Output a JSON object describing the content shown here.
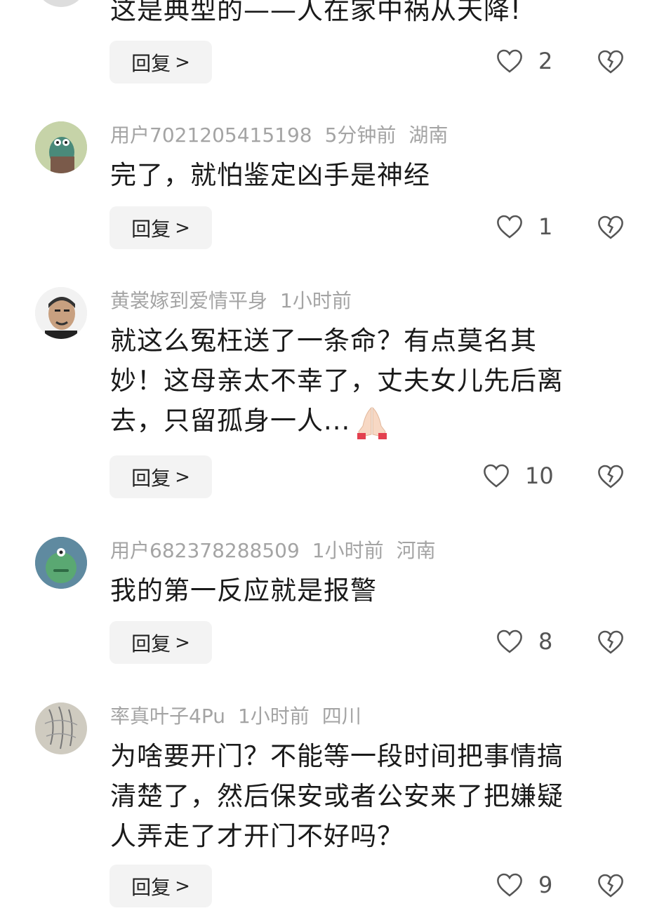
{
  "comments": [
    {
      "text": "这是典型的——人在家中祸从天降!",
      "reply_label": "回复",
      "likes": "2"
    },
    {
      "username": "用户7021205415198",
      "time": "5分钟前",
      "location": "湖南",
      "text": "完了，就怕鉴定凶手是神经",
      "reply_label": "回复",
      "likes": "1"
    },
    {
      "username": "黄裳嫁到爱情平身",
      "time": "1小时前",
      "text_lines": [
        "就这么冤枉送了一条命？有点莫名其",
        "妙！这母亲太不幸了，丈夫女儿先后离",
        "去，只留孤身一人..."
      ],
      "reply_label": "回复",
      "likes": "10"
    },
    {
      "username": "用户682378288509",
      "time": "1小时前",
      "location": "河南",
      "text": "我的第一反应就是报警",
      "reply_label": "回复",
      "likes": "8"
    },
    {
      "username": "率真叶子4Pu",
      "time": "1小时前",
      "location": "四川",
      "text_lines": [
        "为啥要开门？不能等一段时间把事情搞",
        "清楚了，然后保安或者公安来了把嫌疑",
        "人弄走了才开门不好吗？"
      ],
      "reply_label": "回复",
      "likes": "9"
    }
  ],
  "icons": {
    "like": "heart-outline-icon",
    "dislike": "broken-heart-icon",
    "reply_chevron": "chevron-right-icon",
    "praying_hands": "praying-hands-emoji"
  }
}
